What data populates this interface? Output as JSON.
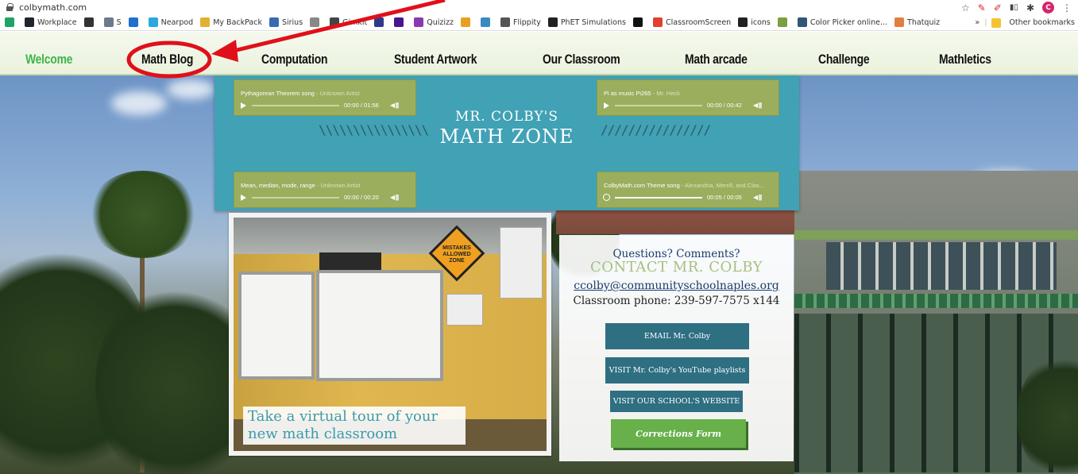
{
  "browser": {
    "url": "colbymath.com",
    "avatar_letter": "C",
    "bookmarks": [
      {
        "label": "",
        "icon": "drive-icon",
        "color": "#1fa463"
      },
      {
        "label": "Workplace",
        "icon": "workplace-icon",
        "color": "#20262e"
      },
      {
        "label": "",
        "icon": "circle-icon",
        "color": "#333333"
      },
      {
        "label": "S",
        "icon": "s-icon",
        "color": "#6b7b8b"
      },
      {
        "label": "",
        "icon": "outlook-icon",
        "color": "#1e6fcf"
      },
      {
        "label": "Nearpod",
        "icon": "nearpod-icon",
        "color": "#2aa8e0"
      },
      {
        "label": "My BackPack",
        "icon": "backpack-icon",
        "color": "#e0b030"
      },
      {
        "label": "Sirius",
        "icon": "sirius-icon",
        "color": "#3a6ab0"
      },
      {
        "label": "",
        "icon": "music-note-icon",
        "color": "#888888"
      },
      {
        "label": "Gimkit",
        "icon": "gimkit-icon",
        "color": "#444444"
      },
      {
        "label": "",
        "icon": "q-icon",
        "color": "#2d3a8c"
      },
      {
        "label": "",
        "icon": "kahoot-icon",
        "color": "#46178f"
      },
      {
        "label": "Quizizz",
        "icon": "quizizz-icon",
        "color": "#8a3ab0"
      },
      {
        "label": "",
        "icon": "globe-icon",
        "color": "#e8a020"
      },
      {
        "label": "",
        "icon": "flask-icon",
        "color": "#3a8ac0"
      },
      {
        "label": "Flippity",
        "icon": "flippity-icon",
        "color": "#555555"
      },
      {
        "label": "PhET Simulations",
        "icon": "phet-icon",
        "color": "#222222"
      },
      {
        "label": "",
        "icon": "x-icon",
        "color": "#111111"
      },
      {
        "label": "ClassroomScreen",
        "icon": "classroomscreen-icon",
        "color": "#e04030"
      },
      {
        "label": "icons",
        "icon": "icons-icon",
        "color": "#222222"
      },
      {
        "label": "",
        "icon": "leaf-icon",
        "color": "#7aa040"
      },
      {
        "label": "Color Picker online...",
        "icon": "color-picker-icon",
        "color": "#335577"
      },
      {
        "label": "Thatquiz",
        "icon": "thatquiz-icon",
        "color": "#e08040"
      }
    ],
    "more_label": "»",
    "other_bookmarks": "Other bookmarks"
  },
  "nav": {
    "items": [
      {
        "label": "Welcome",
        "active": true
      },
      {
        "label": "Math Blog",
        "active": false
      },
      {
        "label": "Computation",
        "active": false
      },
      {
        "label": "Student Artwork",
        "active": false
      },
      {
        "label": "Our Classroom",
        "active": false
      },
      {
        "label": "Math arcade",
        "active": false
      },
      {
        "label": "Challenge",
        "active": false
      },
      {
        "label": "Mathletics",
        "active": false
      }
    ]
  },
  "banner": {
    "title_line1": "MR. COLBY'S",
    "title_line2": "MATH ZONE",
    "slashes_left": "\\\\\\\\\\\\\\\\\\\\\\\\\\\\\\\\",
    "slashes_right": "////////////////",
    "players": [
      {
        "title": "Pythagorean Theorem song",
        "artist": " - Unknown Artist",
        "time": "00:00 / 01:56",
        "progress": 0,
        "state": "play"
      },
      {
        "title": "Pi as music Pi265",
        "artist": " - Mr. Heck",
        "time": "00:00 / 00:42",
        "progress": 0,
        "state": "play"
      },
      {
        "title": "Mean, median, mode, range",
        "artist": " - Unknown Artist",
        "time": "00:00 / 00:20",
        "progress": 0,
        "state": "play"
      },
      {
        "title": "ColbyMath.com Theme song",
        "artist": " - Alexandria, Merrill, and Clas...",
        "time": "00:05 / 00:05",
        "progress": 1,
        "state": "ended"
      }
    ]
  },
  "photo": {
    "caption_line1": "Take a virtual tour of your",
    "caption_line2": "new math classroom",
    "sign_text": "MISTAKES ALLOWED ZONE"
  },
  "contact": {
    "question": "Questions? Comments?",
    "heading": "CONTACT MR. COLBY",
    "email": "ccolby@communityschoolnaples.org",
    "phone": "Classroom phone: 239-597-7575 x144",
    "buttons": {
      "email": "EMAIL Mr. Colby",
      "youtube": "VISIT Mr. Colby's YouTube playlists",
      "school": "VISIT OUR SCHOOL'S WEBSITE",
      "corrections": "Corrections Form"
    }
  },
  "colors": {
    "accent_green": "#3fb54a",
    "banner_teal": "#41a1b5",
    "player_olive": "#9aae5e",
    "button_teal": "#2e6f82",
    "button_green": "#67b04a",
    "annotation_red": "#e0101a"
  }
}
